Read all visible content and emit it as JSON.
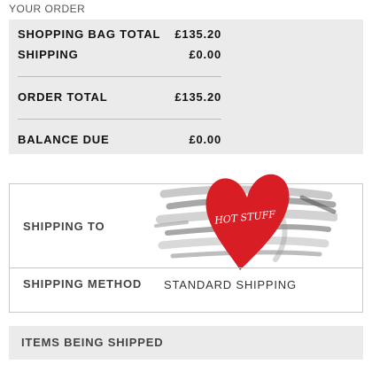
{
  "order": {
    "section_title": "YOUR ORDER",
    "rows": [
      {
        "label": "SHOPPING BAG TOTAL",
        "value": "£135.20"
      },
      {
        "label": "SHIPPING",
        "value": "£0.00"
      },
      {
        "label": "ORDER TOTAL",
        "value": "£135.20"
      },
      {
        "label": "BALANCE DUE",
        "value": "£0.00"
      }
    ]
  },
  "shipping": {
    "to_label": "SHIPPING TO",
    "method_label": "SHIPPING METHOD",
    "method_value": "STANDARD SHIPPING",
    "sticker_text": "HOT STUFF"
  },
  "items": {
    "label": "ITEMS BEING SHIPPED"
  },
  "colors": {
    "panel_bg": "#ebebeb",
    "heart_red": "#d81e24",
    "border": "#c8c8c8"
  }
}
